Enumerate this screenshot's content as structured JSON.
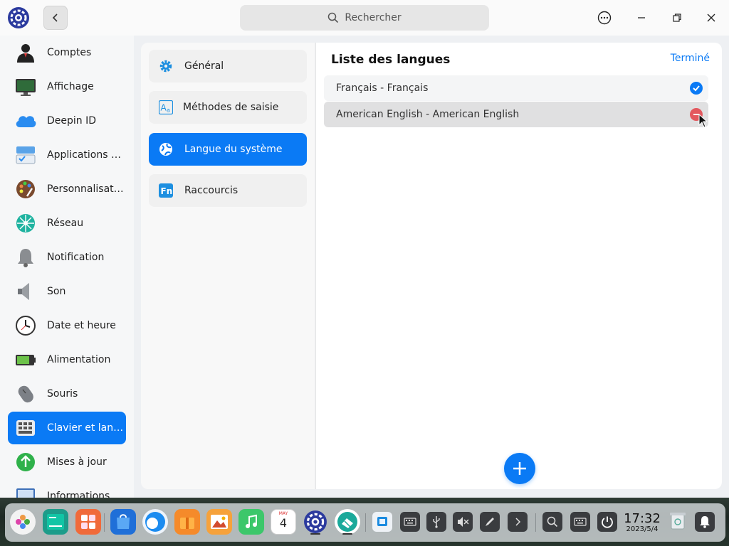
{
  "titlebar": {
    "search_placeholder": "Rechercher"
  },
  "sidebar": {
    "items": [
      {
        "label": "Comptes",
        "icon": "user-icon"
      },
      {
        "label": "Affichage",
        "icon": "monitor-icon"
      },
      {
        "label": "Deepin ID",
        "icon": "cloud-icon"
      },
      {
        "label": "Applications par défaut",
        "icon": "default-apps-icon"
      },
      {
        "label": "Personnalisation",
        "icon": "palette-icon"
      },
      {
        "label": "Réseau",
        "icon": "network-icon"
      },
      {
        "label": "Notification",
        "icon": "bell-icon"
      },
      {
        "label": "Son",
        "icon": "speaker-icon"
      },
      {
        "label": "Date et heure",
        "icon": "clock-icon"
      },
      {
        "label": "Alimentation",
        "icon": "battery-icon"
      },
      {
        "label": "Souris",
        "icon": "mouse-icon"
      },
      {
        "label": "Clavier et langue",
        "icon": "keyboard-icon",
        "active": true
      },
      {
        "label": "Mises à jour",
        "icon": "update-icon"
      },
      {
        "label": "Informations",
        "icon": "info-icon"
      }
    ]
  },
  "submenu": {
    "items": [
      {
        "label": "Général",
        "icon": "gear-icon"
      },
      {
        "label": "Méthodes de saisie",
        "icon": "input-method-icon"
      },
      {
        "label": "Langue du système",
        "icon": "globe-icon",
        "active": true
      },
      {
        "label": "Raccourcis",
        "icon": "shortcut-icon"
      }
    ]
  },
  "main": {
    "title": "Liste des langues",
    "done_label": "Terminé",
    "languages": [
      {
        "label": "Français - Français",
        "state": "selected"
      },
      {
        "label": "American English - American English",
        "state": "delete"
      }
    ]
  },
  "dock": {
    "apps": [
      "launcher-icon",
      "terminal-icon",
      "app-store-icon",
      "deepin-store-icon",
      "browser-icon",
      "archive-icon",
      "image-viewer-icon",
      "music-icon",
      "calendar-icon",
      "settings-icon",
      "remote-assist-icon"
    ],
    "calendar_day": "4",
    "calendar_month": "MAY",
    "clock": {
      "time": "17:32",
      "date": "2023/5/4"
    }
  },
  "colors": {
    "accent": "#0a7af5",
    "delete": "#e3585e"
  }
}
